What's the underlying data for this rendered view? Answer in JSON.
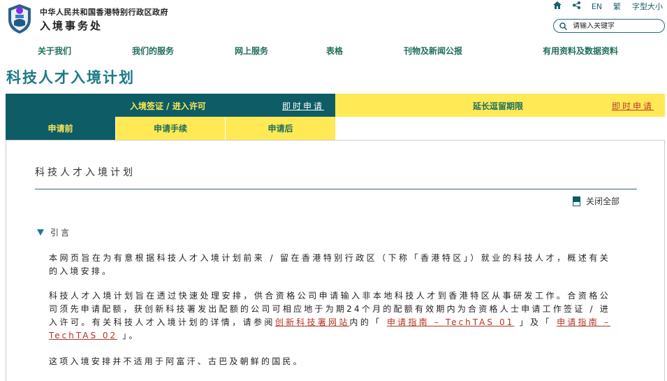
{
  "header": {
    "gov_line": "中华人民共和国香港特别行政区政府",
    "dept": "入境事务处",
    "utils": {
      "lang_en": "EN",
      "lang_tc": "繁",
      "font_size": "字型大小"
    },
    "search_placeholder": "请输入关键字"
  },
  "nav": [
    "关于我们",
    "我们的服务",
    "网上服务",
    "表格",
    "刊物及新闻公报",
    "有用资料及数据资料"
  ],
  "page_title": "科技人才入境计划",
  "tabs": {
    "left_title": "入境签证 / 进入许可",
    "left_apply": "即时申请",
    "right_title": "延长逗留期限",
    "right_apply": "即时申请",
    "sub": [
      "申请前",
      "申请手续",
      "申请后"
    ]
  },
  "content": {
    "title": "科技人才入境计划",
    "collapse_all": "关闭全部",
    "section_title": "引言",
    "p1": "本网页旨在为有意根据科技人才入境计划前来 / 留在香港特别行政区（下称「香港特区」）就业的科技人才，概述有关的入境安排。",
    "p2_a": "科技人才入境计划旨在透过快速处理安排，供合资格公司申请输入非本地科技人才到香港特区从事研发工作。合资格公司须先申请配额，获创新科技署发出配额的公司可相应地于为期24个月的配额有效期内为合资格人士申请工作签证 / 进入许可。有关科技人才入境计划的详情，请参阅",
    "p2_link1": "创新科技署网站",
    "p2_b": "内的「",
    "p2_link2": "申请指南 – TechTAS 01",
    "p2_c": "」及「",
    "p2_link3": "申请指南 – TechTAS 02",
    "p2_d": "」。",
    "p3": "这项入境安排并不适用于阿富汗、古巴及朝鲜的国民。"
  }
}
